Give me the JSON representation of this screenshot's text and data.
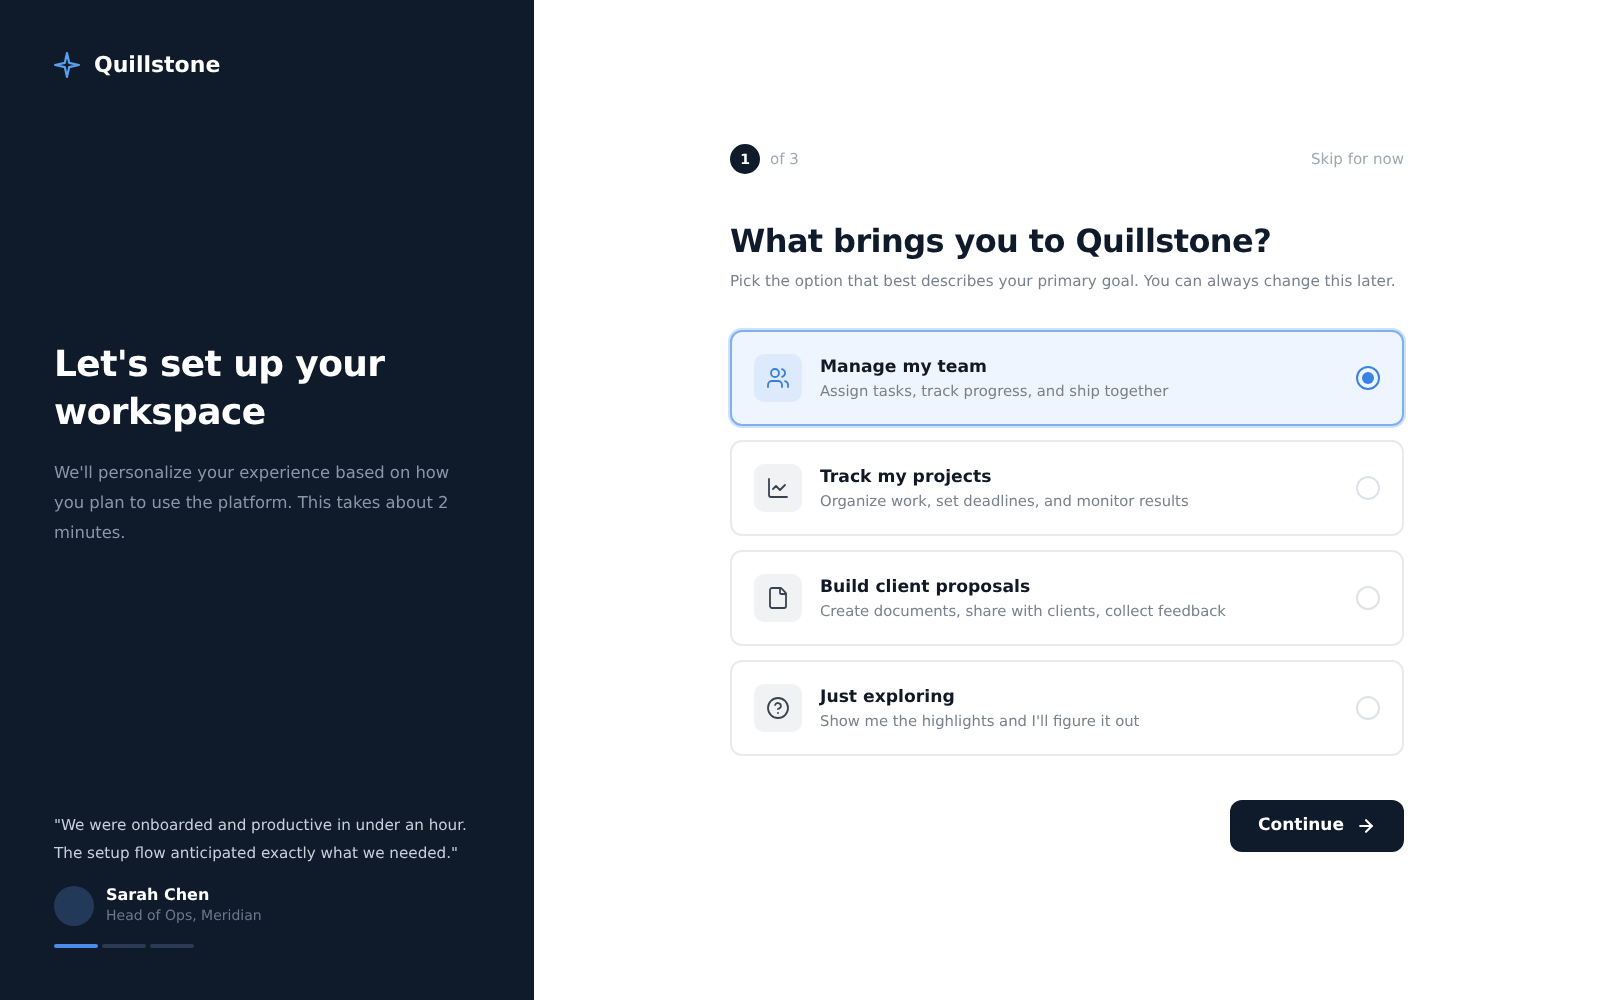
{
  "brand": {
    "name": "Quillstone"
  },
  "intro": {
    "title": "Let's set up your workspace",
    "description": "We'll personalize your experience based on how you plan to use the platform. This takes about 2 minutes."
  },
  "testimonial": {
    "quote": "\"We were onboarded and productive in under an hour. The setup flow anticipated exactly what we needed.\"",
    "author": "Sarah Chen",
    "role": "Head of Ops, Meridian"
  },
  "slides": [
    {
      "selected": true
    },
    {
      "selected": false
    },
    {
      "selected": false
    }
  ],
  "step": {
    "current": "1",
    "total": "of 3"
  },
  "skip_link": "Skip for now",
  "title": "What brings you to Quillstone?",
  "subtitle": "Pick the option that best describes your primary goal. You can always change this later.",
  "options": [
    {
      "kind": "team",
      "title": "Manage my team",
      "description": "Assign tasks, track progress, and ship together",
      "selected": true
    },
    {
      "kind": "chart",
      "title": "Track my projects",
      "description": "Organize work, set deadlines, and monitor results",
      "selected": false
    },
    {
      "kind": "document",
      "title": "Build client proposals",
      "description": "Create documents, share with clients, collect feedback",
      "selected": false
    },
    {
      "kind": "help",
      "title": "Just exploring",
      "description": "Show me the highlights and I'll figure it out",
      "selected": false
    }
  ],
  "continue_button": "Continue"
}
